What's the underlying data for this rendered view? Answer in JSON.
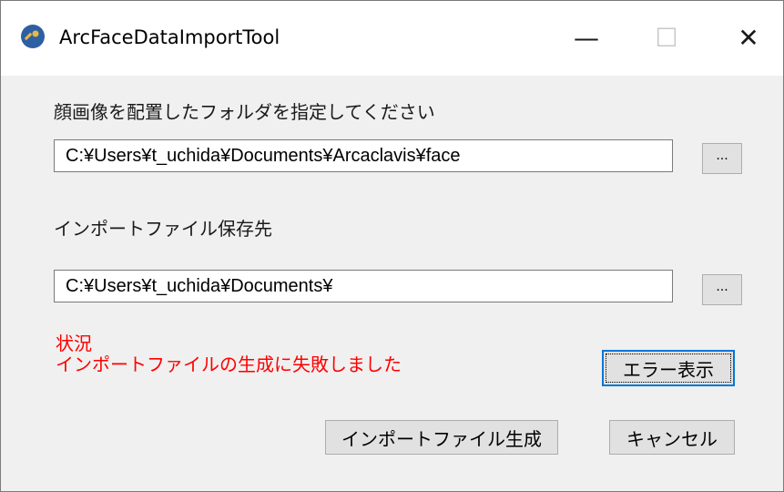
{
  "window": {
    "title": "ArcFaceDataImportTool",
    "controls": {
      "minimize": "—",
      "maximize": "☐",
      "close": "✕"
    }
  },
  "face_folder": {
    "label": "顔画像を配置したフォルダを指定してください",
    "value": "C:¥Users¥t_uchida¥Documents¥Arcaclavis¥face",
    "browse_label": "..."
  },
  "save_dest": {
    "label": "インポートファイル保存先",
    "value": "C:¥Users¥t_uchida¥Documents¥",
    "browse_label": "..."
  },
  "status": {
    "title": "状況",
    "message": "インポートファイルの生成に失敗しました",
    "color": "#ff0000"
  },
  "buttons": {
    "show_error": "エラー表示",
    "generate": "インポートファイル生成",
    "cancel": "キャンセル"
  }
}
